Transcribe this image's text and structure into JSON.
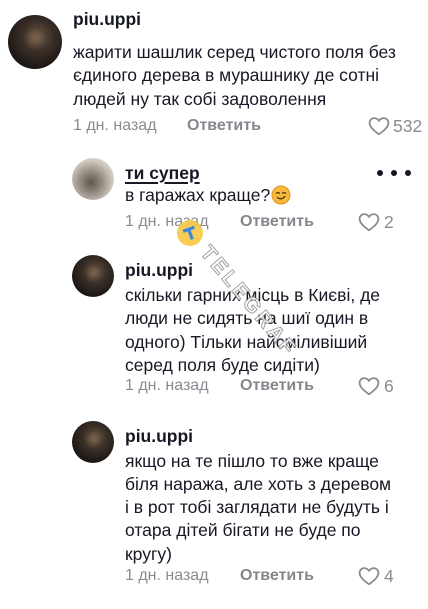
{
  "comment": {
    "username": "piu.uppi",
    "lines": [
      "жарити шашлик серед чистого поля без",
      "єдиного дерева в мурашнику де сотні",
      "людей ну так собі задоволення"
    ],
    "time": "1 дн. назад",
    "reply_label": "Ответить",
    "likes": "532"
  },
  "replies": [
    {
      "username": "ти супер",
      "lines": [
        "в гаражах краще?"
      ],
      "emoji_icon": "smirking-face-emoji",
      "time": "1 дн. назад",
      "reply_label": "Ответить",
      "likes": "2"
    },
    {
      "username": "piu.uppi",
      "lines": [
        "скільки гарних місць в Києві, де",
        "люди не сидять на шиї один в",
        "одного) Тільки найсміливіший",
        "серед поля буде сидіти)"
      ],
      "time": "1 дн. назад",
      "reply_label": "Ответить",
      "likes": "6"
    },
    {
      "username": "piu.uppi",
      "lines": [
        "якщо на те пішло то вже краще",
        "біля наража, але хоть з деревом",
        "і в рот тобі заглядати не будуть і",
        "отара дітей бігати не буде по",
        "кругу)"
      ],
      "time": "1 дн. назад",
      "reply_label": "Ответить",
      "likes": "4"
    }
  ],
  "icons": {
    "like": "heart-outline-icon",
    "more": "more-horizontal-icon",
    "avatar": "user-avatar-image"
  },
  "watermark": {
    "text": "TELEGRAF",
    "logo": "telegraf-logo-icon"
  },
  "colors": {
    "primary_text": "#161823",
    "secondary_text": "#8a8b91",
    "background": "#ffffff",
    "logo_yellow": "#f7c948",
    "logo_blue": "#2f7bd9"
  }
}
